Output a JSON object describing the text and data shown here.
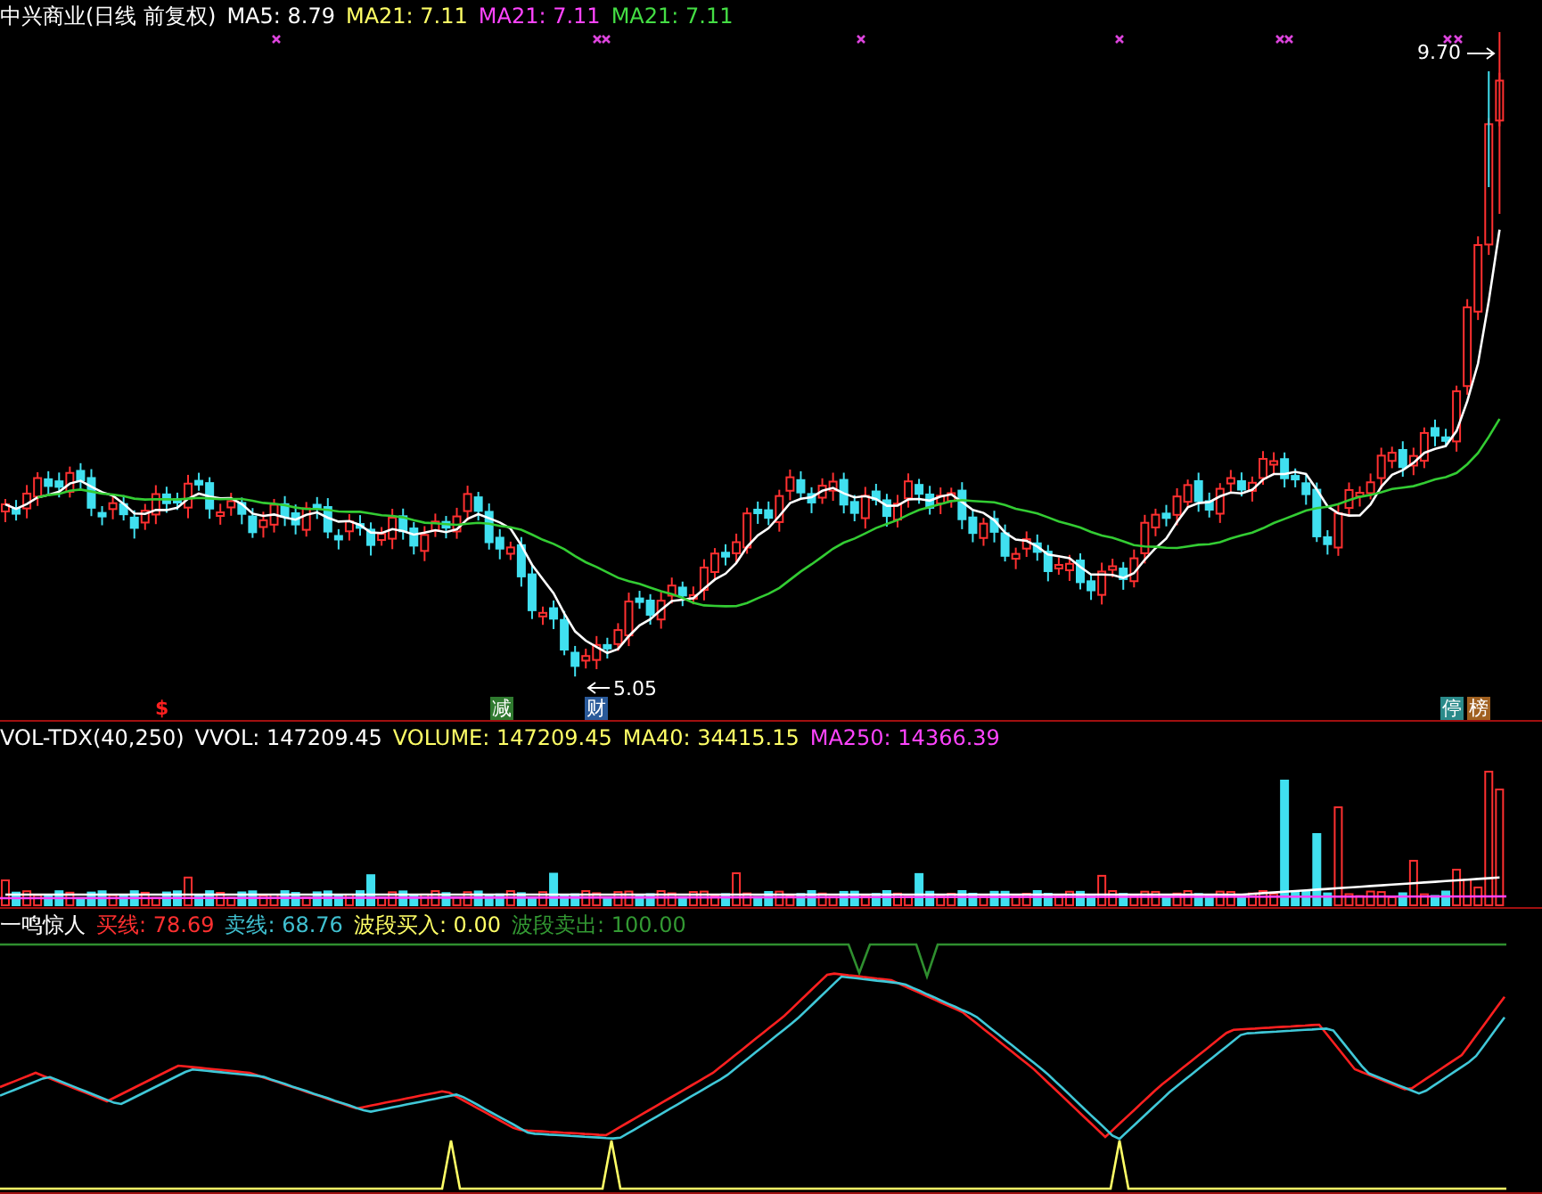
{
  "price_panel": {
    "title": "中兴商业(日线 前复权)",
    "legend": [
      {
        "label": "MA5: 8.79",
        "color": "#ffffff"
      },
      {
        "label": "MA21: 7.11",
        "color": "#ffff66"
      },
      {
        "label": "MA21: 7.11",
        "color": "#ff44ff"
      },
      {
        "label": "MA21: 7.11",
        "color": "#44dd44"
      }
    ],
    "high_label": "9.70",
    "low_label": "5.05",
    "event_marks": [
      {
        "text": "$",
        "kind": "plain",
        "color": "#ff2020"
      },
      {
        "text": "减",
        "kind": "tag",
        "color": "#2f7a2f"
      },
      {
        "text": "财",
        "kind": "tag",
        "color": "#2a5a9a"
      },
      {
        "text": "停",
        "kind": "tag",
        "color": "#2a8a8a"
      },
      {
        "text": "榜",
        "kind": "tag",
        "color": "#a06020"
      }
    ]
  },
  "volume_panel": {
    "title": "VOL-TDX(40,250)",
    "legend": [
      {
        "label": "VVOL: 147209.45",
        "color": "#ffffff"
      },
      {
        "label": "VOLUME: 147209.45",
        "color": "#ffff66"
      },
      {
        "label": "MA40: 34415.15",
        "color": "#ffff66"
      },
      {
        "label": "MA250: 14366.39",
        "color": "#ff44ff"
      }
    ]
  },
  "indicator_panel": {
    "title": "一鸣惊人",
    "legend": [
      {
        "label": "买线: 78.69",
        "color": "#ff3030"
      },
      {
        "label": "卖线: 68.76",
        "color": "#40c0d0"
      },
      {
        "label": "波段买入: 0.00",
        "color": "#ffff66"
      },
      {
        "label": "波段卖出: 100.00",
        "color": "#339933"
      }
    ]
  }
}
